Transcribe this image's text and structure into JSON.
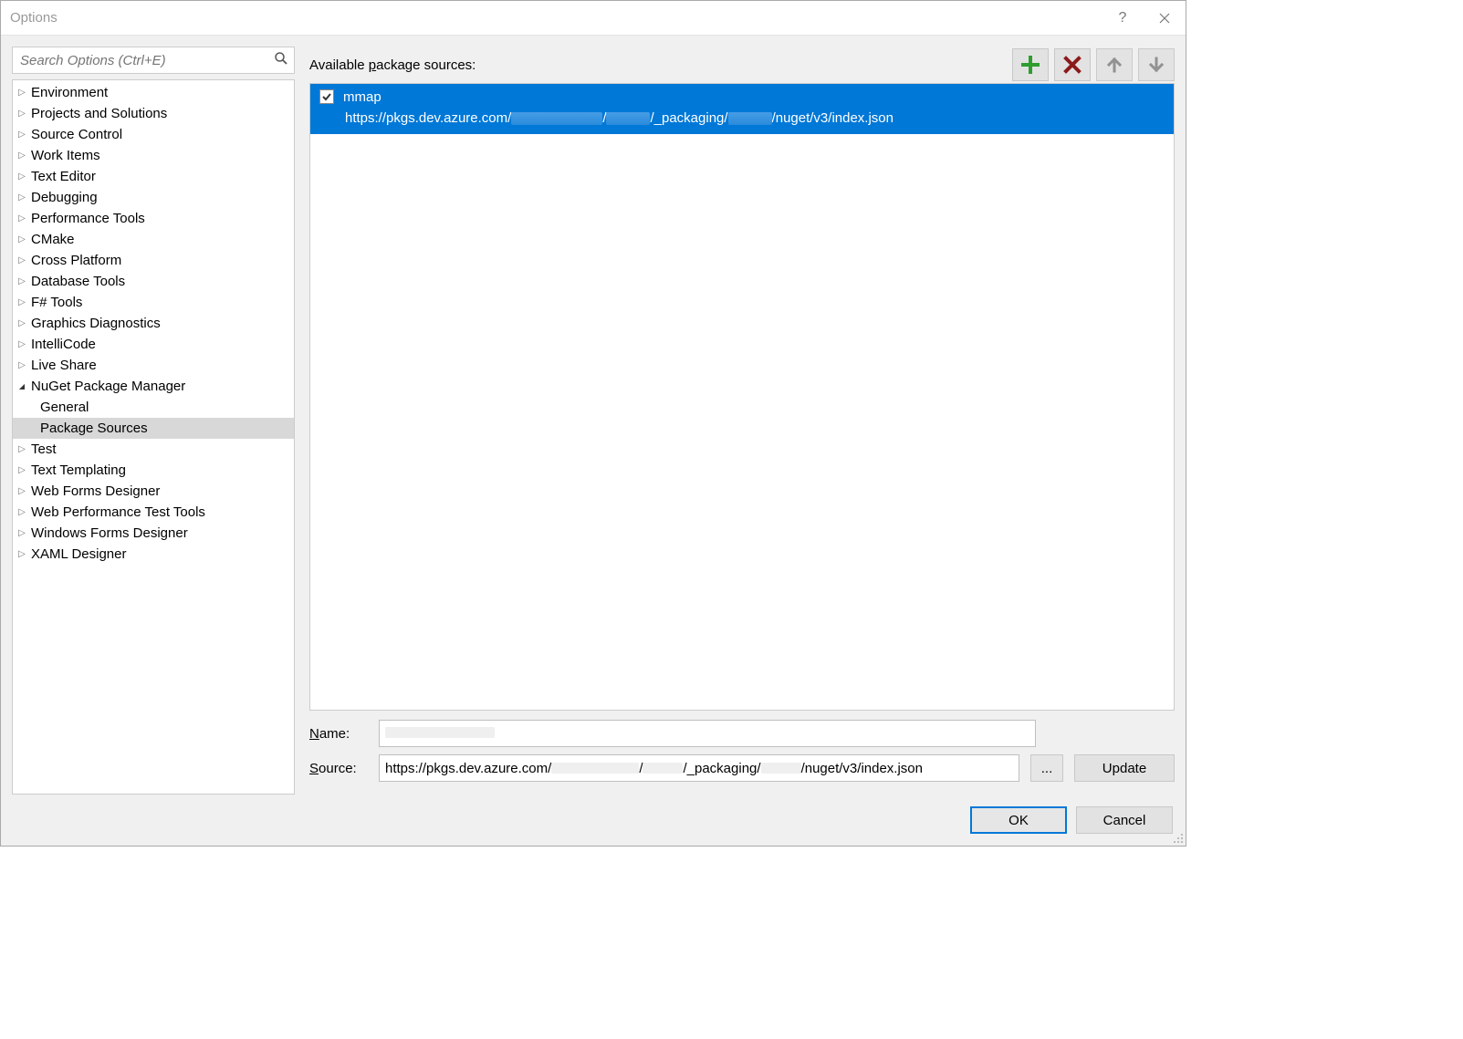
{
  "window": {
    "title": "Options"
  },
  "sidebar": {
    "search_placeholder": "Search Options (Ctrl+E)",
    "items": [
      {
        "label": "Environment",
        "expanded": false
      },
      {
        "label": "Projects and Solutions",
        "expanded": false
      },
      {
        "label": "Source Control",
        "expanded": false
      },
      {
        "label": "Work Items",
        "expanded": false
      },
      {
        "label": "Text Editor",
        "expanded": false
      },
      {
        "label": "Debugging",
        "expanded": false
      },
      {
        "label": "Performance Tools",
        "expanded": false
      },
      {
        "label": "CMake",
        "expanded": false
      },
      {
        "label": "Cross Platform",
        "expanded": false
      },
      {
        "label": "Database Tools",
        "expanded": false
      },
      {
        "label": "F# Tools",
        "expanded": false
      },
      {
        "label": "Graphics Diagnostics",
        "expanded": false
      },
      {
        "label": "IntelliCode",
        "expanded": false
      },
      {
        "label": "Live Share",
        "expanded": false
      },
      {
        "label": "NuGet Package Manager",
        "expanded": true,
        "children": [
          {
            "label": "General",
            "selected": false
          },
          {
            "label": "Package Sources",
            "selected": true
          }
        ]
      },
      {
        "label": "Test",
        "expanded": false
      },
      {
        "label": "Text Templating",
        "expanded": false
      },
      {
        "label": "Web Forms Designer",
        "expanded": false
      },
      {
        "label": "Web Performance Test Tools",
        "expanded": false
      },
      {
        "label": "Windows Forms Designer",
        "expanded": false
      },
      {
        "label": "XAML Designer",
        "expanded": false
      }
    ]
  },
  "main": {
    "header_prefix": "Available ",
    "header_underlined": "p",
    "header_suffix": "ackage sources:",
    "sources": [
      {
        "checked": true,
        "name": "mmap",
        "url_parts": [
          "https://pkgs.dev.azure.com/",
          "/",
          "/_packaging/",
          "/nuget/v3/index.json"
        ]
      }
    ],
    "form": {
      "name_label_u": "N",
      "name_label_rest": "ame:",
      "name_value": "",
      "source_label_u": "S",
      "source_label_rest": "ource:",
      "source_parts": [
        "https://pkgs.dev.azure.com/",
        "/",
        "/_packaging/",
        "/nuget/v3/index.json"
      ],
      "browse_label": "...",
      "update_label_u": "U",
      "update_label_rest": "pdate"
    }
  },
  "footer": {
    "ok": "OK",
    "cancel": "Cancel"
  }
}
